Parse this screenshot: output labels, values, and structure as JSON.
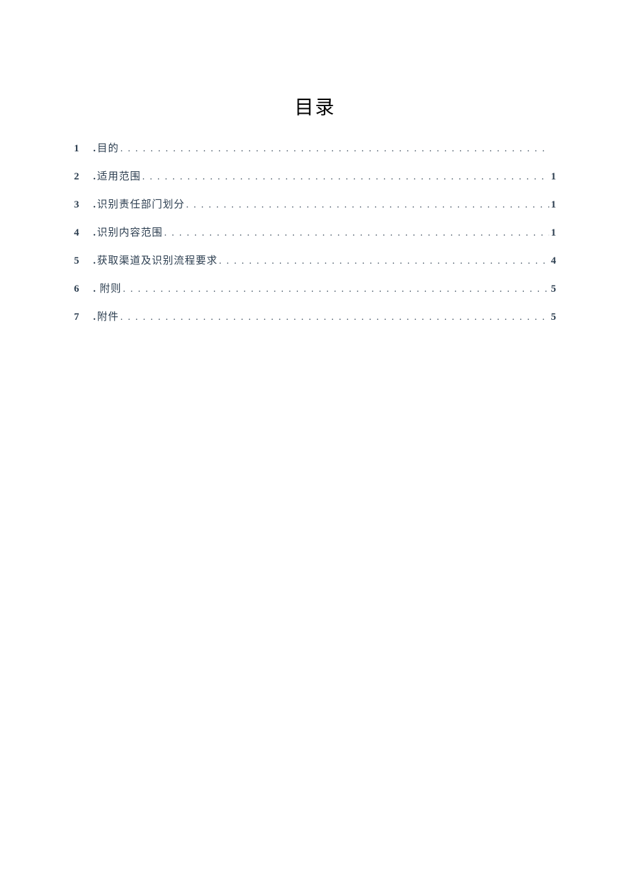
{
  "title": "目录",
  "toc": [
    {
      "num": "1",
      "label": "目的",
      "page": ""
    },
    {
      "num": "2",
      "label": "适用范围",
      "page": "1"
    },
    {
      "num": "3",
      "label": "识别责任部门划分",
      "page": "1"
    },
    {
      "num": "4",
      "label": "识别内容范围",
      "page": "1"
    },
    {
      "num": "5",
      "label": "获取渠道及识别流程要求",
      "page": "4"
    },
    {
      "num": "6",
      "label": "附则",
      "page": "5"
    },
    {
      "num": "7",
      "label": "附件",
      "page": "5"
    }
  ]
}
